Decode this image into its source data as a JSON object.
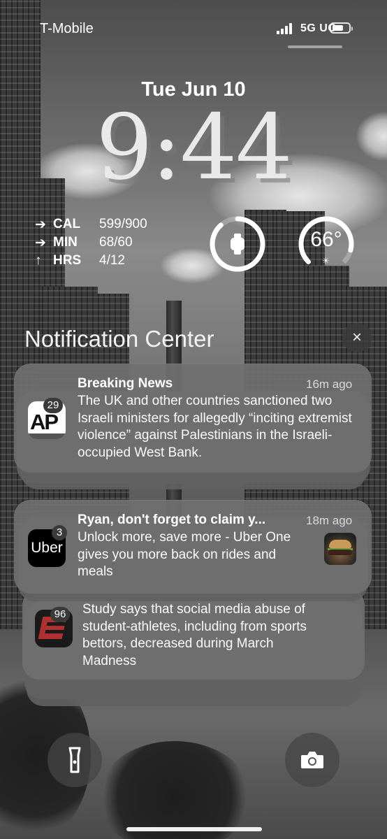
{
  "status_bar": {
    "carrier": "T-Mobile",
    "network": "5G UC",
    "battery_level": 0.7
  },
  "lock_screen": {
    "date": "Tue Jun 10",
    "time": "9:44",
    "fitness": [
      {
        "arrow": "➔",
        "label": "CAL",
        "value": "599/900"
      },
      {
        "arrow": "➔",
        "label": "MIN",
        "value": "68/60"
      },
      {
        "arrow": "↑",
        "label": "HRS",
        "value": "4/12"
      }
    ],
    "widgets": {
      "activity_icon": "watch-icon",
      "temperature": "66°",
      "weather_icon": "sun-icon"
    }
  },
  "notification_center": {
    "title": "Notification Center",
    "close_icon": "×",
    "notifications": [
      {
        "app": "AP",
        "icon_text": "AP",
        "badge": "29",
        "title": "Breaking News",
        "time": "16m ago",
        "body": "The UK and other countries sanctioned two Israeli ministers for allegedly “inciting extremist violence” against Palestinians in the Israeli-occupied West Bank."
      },
      {
        "app": "Uber",
        "icon_text": "Uber",
        "badge": "3",
        "title": "Ryan, don't forget to claim y...",
        "time": "18m ago",
        "body": "Unlock more, save more - Uber One gives you more back on rides and meals",
        "thumbnail": "burger-thumbnail"
      },
      {
        "app": "ESPN",
        "badge": "96",
        "title": "",
        "time": "",
        "body_lines": [
          "Study says that social media abuse of",
          "student-athletes, including from sports",
          "bettors, decreased during March",
          "Madness"
        ]
      }
    ]
  },
  "bottom_controls": {
    "left": "flashlight-icon",
    "right": "camera-icon"
  }
}
